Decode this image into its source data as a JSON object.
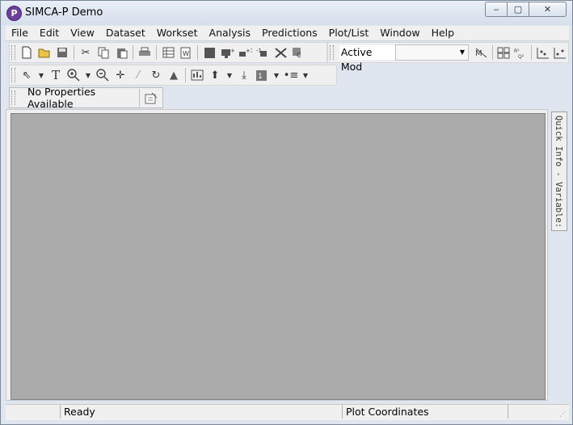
{
  "window": {
    "title": "SIMCA-P Demo",
    "app_icon_letter": "P",
    "controls": {
      "minimize": "‒",
      "maximize": "▢",
      "close": "✕"
    }
  },
  "menu": [
    "File",
    "Edit",
    "View",
    "Dataset",
    "Workset",
    "Analysis",
    "Predictions",
    "Plot/List",
    "Window",
    "Help"
  ],
  "toolbar": {
    "active_model_label": "Active Mod",
    "active_model_value": ""
  },
  "properties_bar": {
    "text": "No Properties Available"
  },
  "quick_info": {
    "label": "Quick Info - Variable:"
  },
  "status": {
    "cell0": "",
    "ready": "Ready",
    "plot_coordinates": "Plot Coordinates"
  },
  "colors": {
    "workspace": "#ababab",
    "titlebar": "#dfe6ef",
    "app_icon": "#6b3f9a"
  }
}
